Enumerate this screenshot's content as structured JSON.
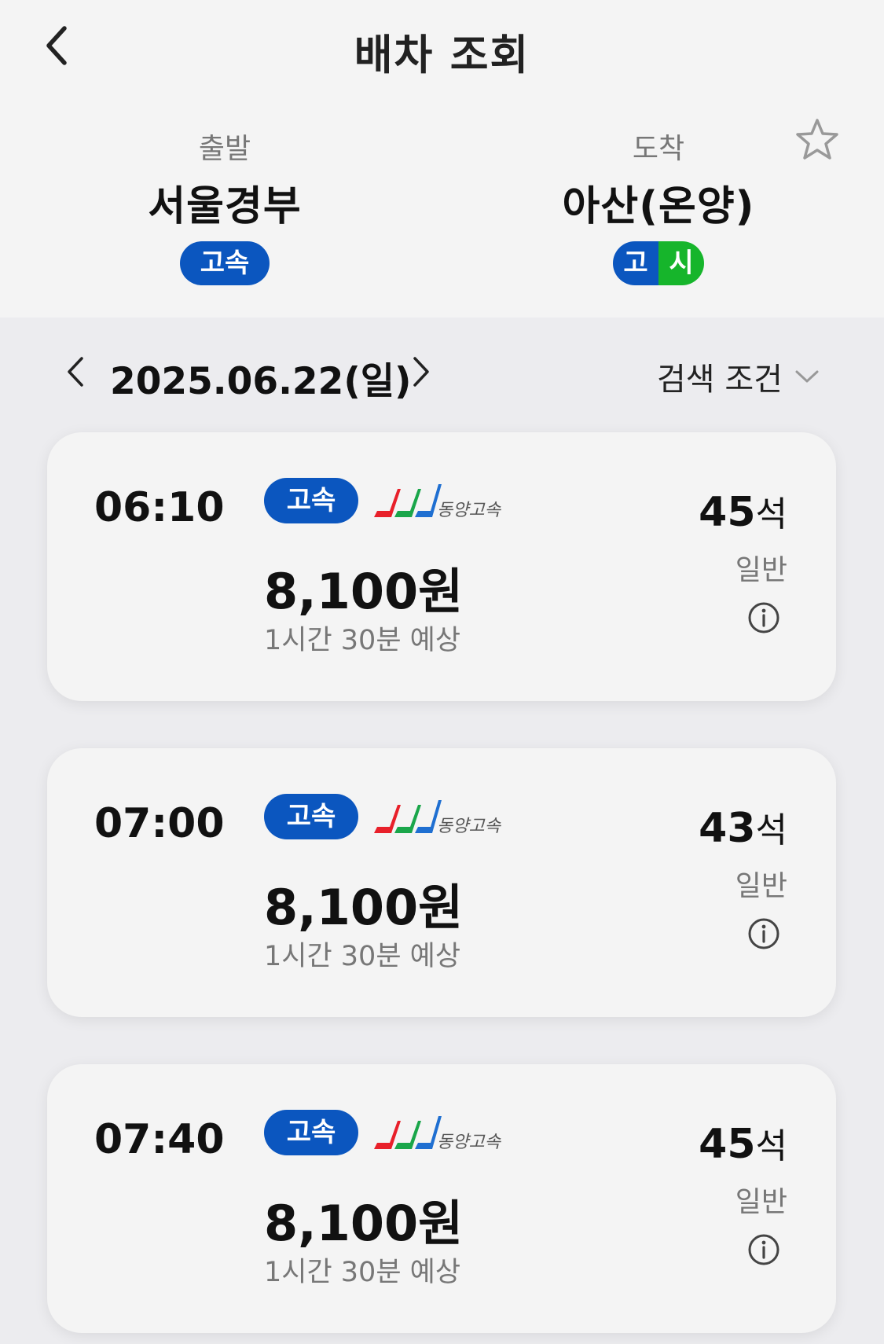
{
  "header": {
    "title": "배차 조회"
  },
  "departure": {
    "label": "출발",
    "name": "서울경부",
    "badge": "고속"
  },
  "arrival": {
    "label": "도착",
    "name": "아산(온양)",
    "badge_left": "고",
    "badge_right": "시"
  },
  "date": {
    "text": "2025.06.22(일)"
  },
  "filter": {
    "label": "검색 조건"
  },
  "company": {
    "name": "동양고속"
  },
  "schedules": [
    {
      "time": "06:10",
      "grade": "고속",
      "price": "8,100원",
      "duration": "1시간 30분 예상",
      "seats": "45",
      "seat_unit": "석",
      "seat_type": "일반"
    },
    {
      "time": "07:00",
      "grade": "고속",
      "price": "8,100원",
      "duration": "1시간 30분 예상",
      "seats": "43",
      "seat_unit": "석",
      "seat_type": "일반"
    },
    {
      "time": "07:40",
      "grade": "고속",
      "price": "8,100원",
      "duration": "1시간 30분 예상",
      "seats": "45",
      "seat_unit": "석",
      "seat_type": "일반"
    }
  ],
  "colors": {
    "express_blue": "#0b56bf",
    "intercity_green": "#16b52b",
    "logo_red": "#e8202a",
    "logo_green": "#1aa64a",
    "logo_blue": "#1f6fd1"
  },
  "icons": {
    "back": "chevron-left-icon",
    "favorite": "star-outline-icon",
    "prev_date": "chevron-left-icon",
    "next_date": "chevron-right-icon",
    "filter": "chevron-down-icon",
    "info": "info-circle-icon"
  }
}
